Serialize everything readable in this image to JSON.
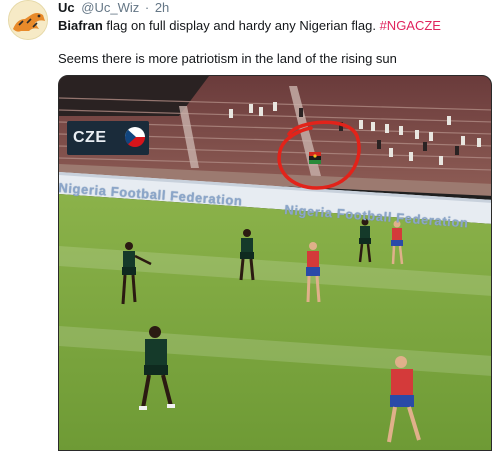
{
  "author": {
    "name": "Uc",
    "handle": "@Uc_Wiz",
    "separator": "·",
    "time": "2h"
  },
  "text": {
    "bold_word": "Biafran",
    "line1_rest": " flag on full display and hardy any Nigerian flag. ",
    "hashtag": "#NGACZE",
    "line2": "Seems there is more patriotism in the land of the rising sun"
  },
  "media": {
    "score_badge": "CZE",
    "board_text_left": "Nigeria Football Federation",
    "board_text_right": "Nigeria Football Federation",
    "icons": [
      "avatar-icon",
      "czech-flag-icon",
      "highlight-circle-icon",
      "biafran-flag-icon"
    ]
  },
  "colors": {
    "hashtag": "#e0245e",
    "pitch": "#79a33b",
    "highlight_circle": "#e2231a"
  }
}
